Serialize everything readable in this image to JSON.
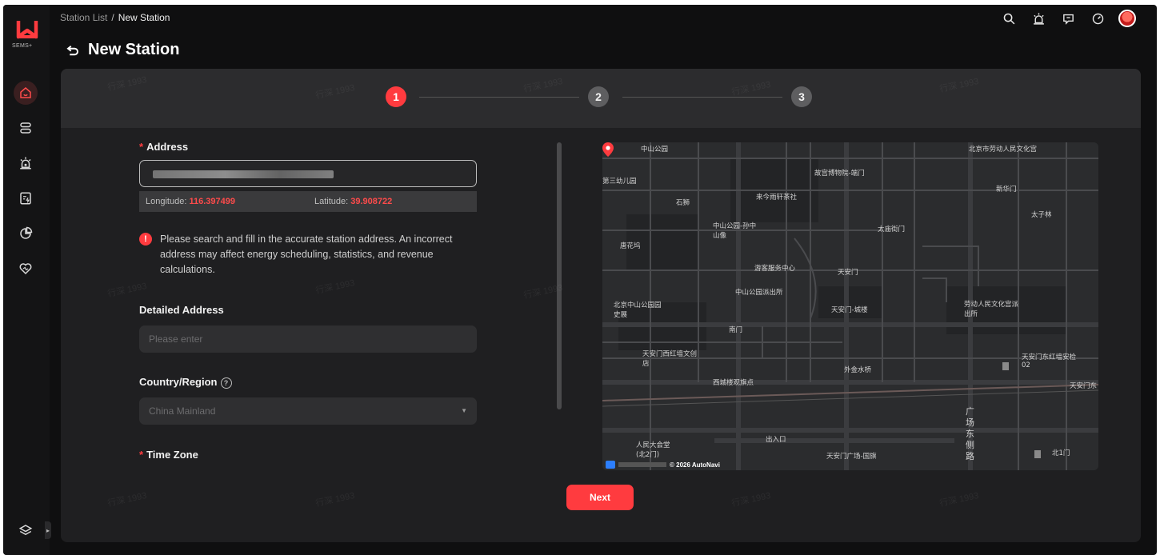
{
  "breadcrumb": {
    "parent": "Station List",
    "separator": "/",
    "current": "New Station"
  },
  "page": {
    "title": "New Station"
  },
  "app": {
    "logo_text": "SEMS+"
  },
  "steps": [
    "1",
    "2",
    "3"
  ],
  "form": {
    "address_label": "Address",
    "longitude_label": "Longitude:",
    "longitude_value": "116.397499",
    "latitude_label": "Latitude:",
    "latitude_value": "39.908722",
    "warning_text": "Please search and fill in the accurate station address. An incorrect address may affect energy scheduling, statistics, and revenue calculations.",
    "detailed_address_label": "Detailed Address",
    "detailed_address_placeholder": "Please enter",
    "country_label": "Country/Region",
    "country_value": "China Mainland",
    "timezone_label": "Time Zone",
    "next_label": "Next"
  },
  "map": {
    "labels": [
      "中山公园",
      "北京市劳动人民文化宫",
      "故宫博物院-端门",
      "第三幼儿园",
      "石狮",
      "来今雨轩茶社",
      "新华门",
      "太子林",
      "中山公园-孙中山像",
      "太庙街门",
      "唐花坞",
      "游客服务中心",
      "天安门",
      "北京中山公园园史展",
      "中山公园派出所",
      "天安门-城楼",
      "劳动人民文化宫派出所",
      "南门",
      "天安门西红墙文创店",
      "天安门东红墙安检02",
      "外金水桥",
      "西城楼观旗点",
      "天安门东",
      "人民大会堂(北2门)",
      "出入口",
      "天安门广场-国旗",
      "广场东侧路",
      "北1门"
    ],
    "copyright": "© 2026 AutoNavi"
  },
  "watermark": "行深 1993",
  "colors": {
    "accent": "#ff3b3f",
    "background": "#0f0f10",
    "card": "#1f1f21"
  }
}
